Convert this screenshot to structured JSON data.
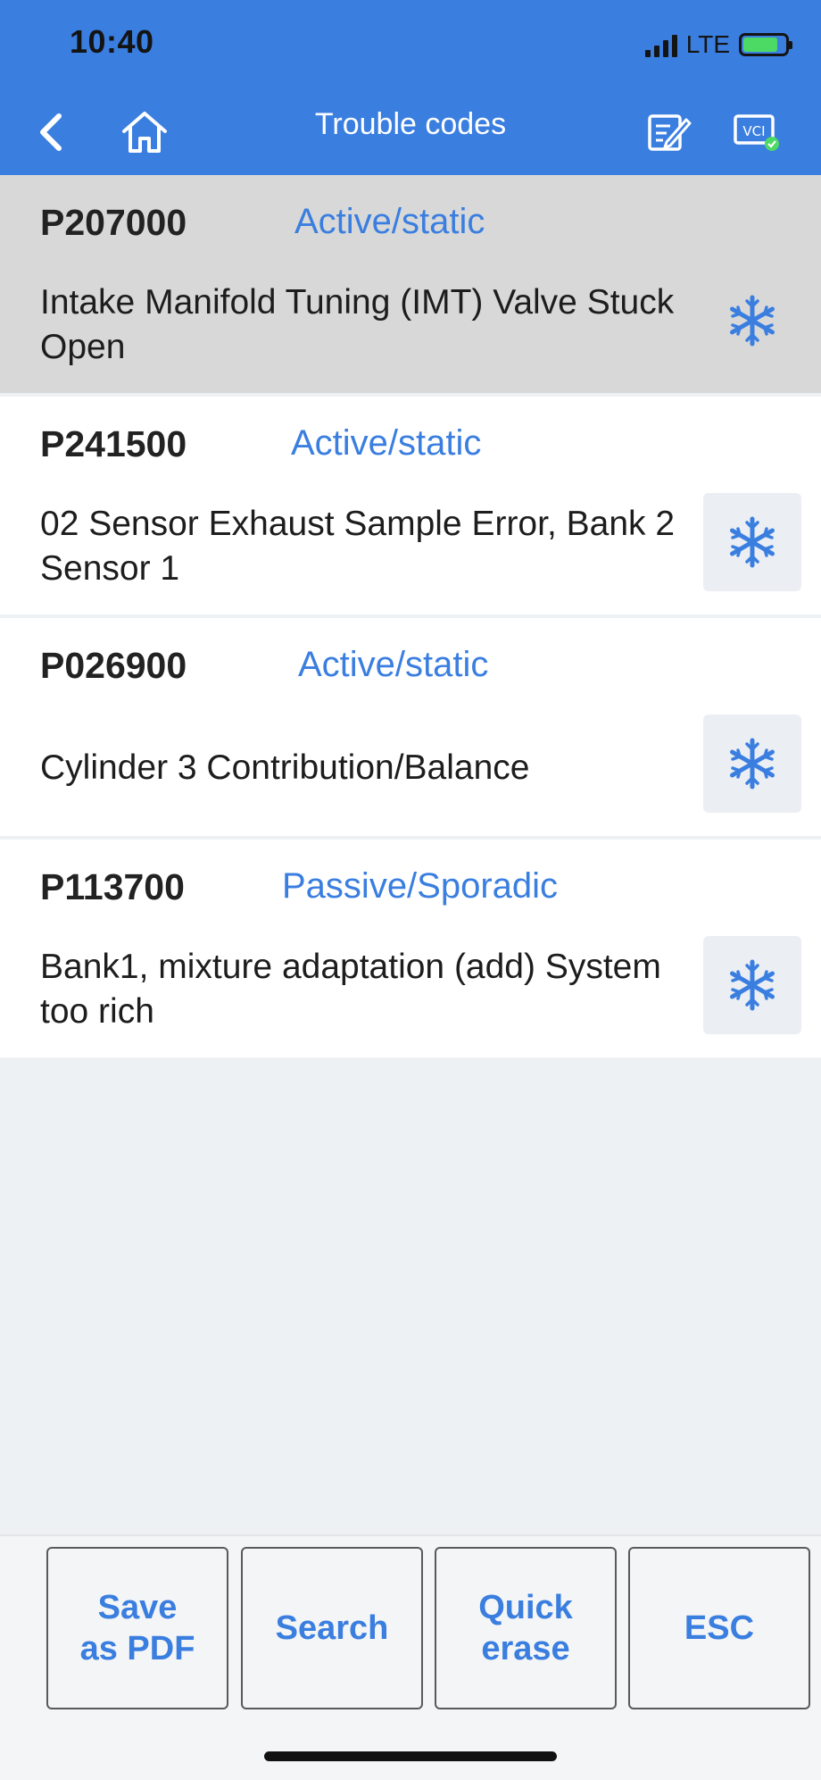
{
  "status_bar": {
    "time": "10:40",
    "network": "LTE"
  },
  "nav": {
    "title": "Trouble codes"
  },
  "codes": [
    {
      "code": "P207000",
      "status": "Active/static",
      "description": "Intake Manifold Tuning (IMT) Valve Stuck Open",
      "selected": true
    },
    {
      "code": "P241500",
      "status": "Active/static",
      "description": "02 Sensor Exhaust Sample Error, Bank 2 Sensor 1"
    },
    {
      "code": "P026900",
      "status": "Active/static",
      "description": "Cylinder 3 Contribution/Balance"
    },
    {
      "code": "P113700",
      "status": "Passive/Sporadic",
      "description": "Bank1, mixture adaptation (add) System too rich"
    }
  ],
  "bottom_buttons": {
    "save_pdf": "Save\nas PDF",
    "search": "Search",
    "quick_erase": "Quick\nerase",
    "esc": "ESC"
  },
  "colors": {
    "accent": "#3a7ee0",
    "selected_row": "#d8d8d8",
    "background": "#eef1f4"
  }
}
